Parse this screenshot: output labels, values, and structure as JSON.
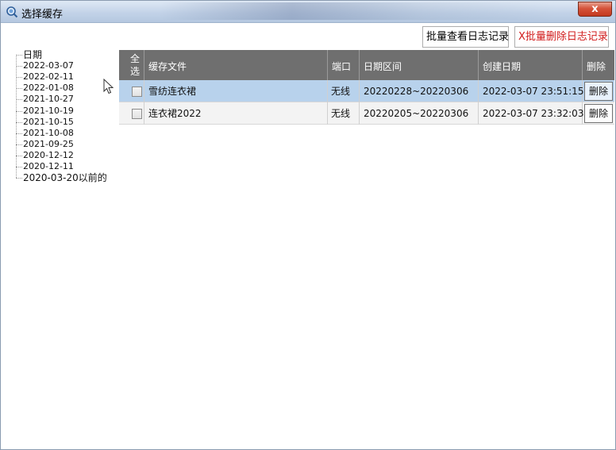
{
  "window": {
    "title": "选择缓存",
    "close_label": "x"
  },
  "toolbar": {
    "view_label": "批量查看日志记录",
    "delete_label": "X批量删除日志记录"
  },
  "tree": {
    "root_label": "日期",
    "items": [
      "2022-03-07",
      "2022-02-11",
      "2022-01-08",
      "2021-10-27",
      "2021-10-19",
      "2021-10-15",
      "2021-10-08",
      "2021-09-25",
      "2020-12-12",
      "2020-12-11",
      "2020-03-20以前的"
    ]
  },
  "grid": {
    "headers": {
      "select_all": "全选",
      "file": "缓存文件",
      "port": "端口",
      "range": "日期区间",
      "created": "创建日期",
      "delete": "删除"
    },
    "rows": [
      {
        "file": "雪纺连衣裙",
        "port": "无线",
        "range": "20220228~20220306",
        "created": "2022-03-07 23:51:15",
        "delete_label": "删除"
      },
      {
        "file": "连衣裙2022",
        "port": "无线",
        "range": "20220205~20220306",
        "created": "2022-03-07 23:32:03",
        "delete_label": "删除"
      }
    ]
  },
  "colors": {
    "header_bg": "#6f6f6f",
    "selected_row": "#b8d2ec",
    "delete_text": "#d11a1a"
  },
  "icons": {
    "app": "magnifier-icon",
    "close": "close-icon"
  }
}
